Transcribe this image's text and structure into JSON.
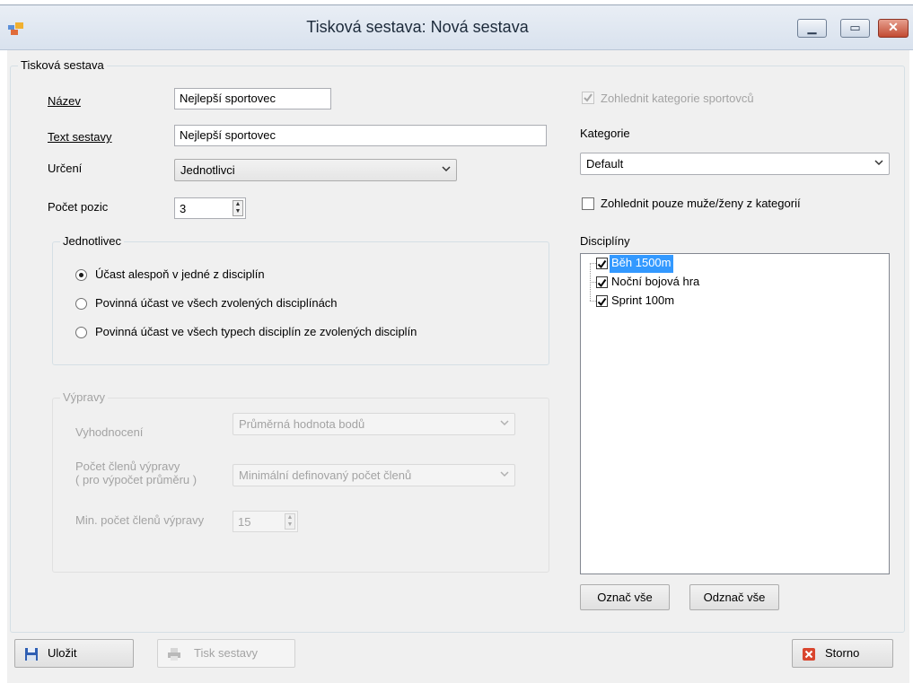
{
  "window": {
    "title": "Tisková sestava: Nová sestava"
  },
  "main_group": {
    "legend": "Tisková sestava"
  },
  "fields": {
    "nazev_label": "Název",
    "nazev_value": "Nejlepší sportovec",
    "text_label": "Text sestavy",
    "text_value": "Nejlepší sportovec",
    "urceni_label": "Určení",
    "urceni_value": "Jednotlivci",
    "pocet_label": "Počet pozic",
    "pocet_value": "3"
  },
  "jednotlivec": {
    "legend": "Jednotlivec",
    "options": [
      {
        "label": "Účast alespoň v jedné z disciplín",
        "selected": true
      },
      {
        "label": "Povinná účast ve všech zvolených disciplínách",
        "selected": false
      },
      {
        "label": "Povinná účast ve všech typech disciplín ze zvolených disciplín",
        "selected": false
      }
    ]
  },
  "vypravy": {
    "legend": "Výpravy",
    "vyhodnoceni_label": "Vyhodnocení",
    "vyhodnoceni_value": "Průměrná hodnota bodů",
    "pocet_clenu_label_1": "Počet členů výpravy",
    "pocet_clenu_label_2": "( pro výpočet průměru )",
    "pocet_clenu_value": "Minimální definovaný počet členů",
    "min_pocet_label": "Min. počet členů výpravy",
    "min_pocet_value": "15"
  },
  "right": {
    "zohlednit_kategorie_label": "Zohlednit kategorie sportovců",
    "zohlednit_kategorie_checked": true,
    "kategorie_label": "Kategorie",
    "kategorie_value": "Default",
    "zohlednit_pohlavi_label": "Zohlednit pouze muže/ženy z kategorií",
    "zohlednit_pohlavi_checked": false,
    "discipliny_label": "Disciplíny",
    "discipliny": [
      {
        "label": "Běh 1500m",
        "checked": true,
        "selected": true
      },
      {
        "label": "Noční bojová hra",
        "checked": true,
        "selected": false
      },
      {
        "label": "Sprint 100m",
        "checked": true,
        "selected": false
      }
    ],
    "oznac_vse": "Označ vše",
    "odznac_vse": "Odznač vše"
  },
  "buttons": {
    "ulozit": "Uložit",
    "tisk": "Tisk sestavy",
    "storno": "Storno"
  },
  "icons": {
    "app": "app-icon",
    "save": "floppy-disk-icon",
    "print": "printer-icon",
    "cancel": "red-x-icon"
  }
}
